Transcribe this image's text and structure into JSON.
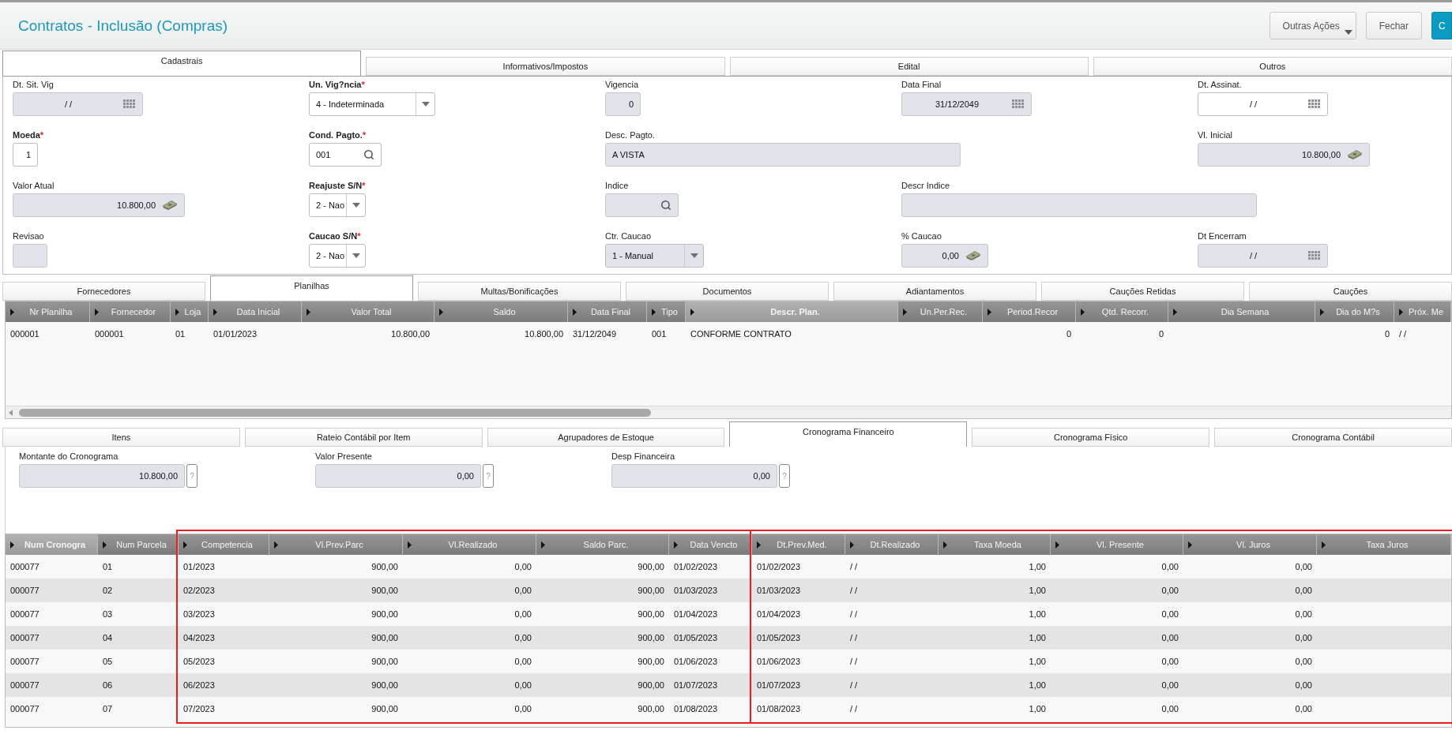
{
  "window": {
    "title": "Contratos - Inclusão (Compras)"
  },
  "actions": [
    {
      "label": "Outras Ações",
      "kind": "menu"
    },
    {
      "label": "Fechar",
      "kind": "default"
    },
    {
      "label": "C",
      "kind": "primary"
    }
  ],
  "main_tabs": [
    {
      "label": "Cadastrais",
      "selected": true
    },
    {
      "label": "Informativos/Impostos",
      "selected": false
    },
    {
      "label": "Edital",
      "selected": false
    },
    {
      "label": "Outros",
      "selected": false
    }
  ],
  "fields": [
    {
      "label": "Dt. Sit. Vig",
      "required": false,
      "kind": "date",
      "disabled": true,
      "value": "/ /"
    },
    {
      "label": "Un. Vig?ncia",
      "required": true,
      "asterisk": "*",
      "kind": "select",
      "disabled": false,
      "value": "4 - Indeterminada"
    },
    {
      "label": "Vigencia",
      "required": false,
      "kind": "number",
      "disabled": true,
      "value": "0"
    },
    {
      "label": "Data Final",
      "required": false,
      "kind": "date",
      "disabled": true,
      "value": "31/12/2049"
    },
    {
      "label": "Dt. Assinat.",
      "required": false,
      "kind": "date",
      "disabled": false,
      "value": "/ /"
    },
    {
      "label": "Moeda",
      "required": true,
      "asterisk": "*",
      "kind": "number",
      "disabled": false,
      "value": "1"
    },
    {
      "label": "Cond. Pagto.",
      "required": true,
      "asterisk": "*",
      "kind": "search",
      "disabled": false,
      "value": "001"
    },
    {
      "label": "Desc. Pagto.",
      "required": false,
      "kind": "text",
      "disabled": true,
      "value": "A VISTA"
    },
    {
      "label": "Vl. Inicial",
      "required": false,
      "kind": "money",
      "disabled": true,
      "value": "10.800,00"
    },
    {
      "label": "Valor Atual",
      "required": false,
      "kind": "money",
      "disabled": true,
      "value": "10.800,00"
    },
    {
      "label": "Reajuste S/N",
      "required": true,
      "asterisk": "*",
      "kind": "select",
      "disabled": false,
      "value": "2 - Nao"
    },
    {
      "label": "Indice",
      "required": false,
      "kind": "search",
      "disabled": true
    },
    {
      "label": "Descr Indice",
      "required": false,
      "kind": "text",
      "disabled": true
    },
    {
      "label": "Revisao",
      "required": false,
      "kind": "text",
      "disabled": true
    },
    {
      "label": "Caucao S/N",
      "required": true,
      "asterisk": "*",
      "kind": "select",
      "disabled": false,
      "value": "2 - Nao"
    },
    {
      "label": "Ctr. Caucao",
      "required": false,
      "kind": "select",
      "disabled": true,
      "value": "1 - Manual"
    },
    {
      "label": "% Caucao",
      "required": false,
      "kind": "money",
      "disabled": true,
      "value": "0,00"
    },
    {
      "label": "Dt Encerram",
      "required": false,
      "kind": "date",
      "disabled": true,
      "value": "/ /"
    }
  ],
  "detail_tabs": [
    {
      "label": "Fornecedores",
      "selected": false
    },
    {
      "label": "Planilhas",
      "selected": true
    },
    {
      "label": "Multas/Bonificações",
      "selected": false
    },
    {
      "label": "Documentos",
      "selected": false
    },
    {
      "label": "Adiantamentos",
      "selected": false
    },
    {
      "label": "Cauções Retidas",
      "selected": false
    },
    {
      "label": "Cauções",
      "selected": false
    }
  ],
  "planilhas": {
    "columns": [
      {
        "label": "Nr Planilha",
        "kind": "text",
        "selected": false
      },
      {
        "label": "Fornecedor",
        "kind": "text",
        "selected": false
      },
      {
        "label": "Loja",
        "kind": "text",
        "selected": false
      },
      {
        "label": "Data Inicial",
        "kind": "text",
        "selected": false
      },
      {
        "label": "Valor Total",
        "kind": "number",
        "selected": false
      },
      {
        "label": "Saldo",
        "kind": "number",
        "selected": false
      },
      {
        "label": "Data Final",
        "kind": "text",
        "selected": false
      },
      {
        "label": "Tipo",
        "kind": "text",
        "selected": false
      },
      {
        "label": "Descr. Plan.",
        "kind": "text",
        "selected": true
      },
      {
        "label": "Un.Per.Rec.",
        "kind": "text",
        "selected": false
      },
      {
        "label": "Period.Recor",
        "kind": "number",
        "selected": false
      },
      {
        "label": "Qtd. Recorr.",
        "kind": "number",
        "selected": false
      },
      {
        "label": "Dia Semana",
        "kind": "text",
        "selected": false
      },
      {
        "label": "Dia do M?s",
        "kind": "number",
        "selected": false
      },
      {
        "label": "Próx. Me",
        "kind": "text",
        "selected": false
      }
    ],
    "rows": [
      [
        "000001",
        "000001",
        "01",
        "01/01/2023",
        "10.800,00",
        "10.800,00",
        "31/12/2049",
        "001",
        "CONFORME CONTRATO",
        null,
        "0",
        "0",
        null,
        "0",
        "/ /"
      ]
    ]
  },
  "item_tabs": [
    {
      "label": "Itens",
      "selected": false
    },
    {
      "label": "Rateio Contábil por Item",
      "selected": false
    },
    {
      "label": "Agrupadores de Estoque",
      "selected": false
    },
    {
      "label": "Cronograma Financeiro",
      "selected": true
    },
    {
      "label": "Cronograma Físico",
      "selected": false
    },
    {
      "label": "Cronograma Contábil",
      "selected": false
    }
  ],
  "totals": [
    {
      "label": "Montante do Cronograma",
      "value": "10.800,00",
      "help": "?"
    },
    {
      "label": "Valor Presente",
      "value": "0,00",
      "help": "?"
    },
    {
      "label": "Desp Financeira",
      "value": "0,00",
      "help": "?"
    }
  ],
  "cronograma": {
    "columns": [
      {
        "label": "Num Cronogra",
        "kind": "text",
        "selected": true,
        "marked": false
      },
      {
        "label": "Num Parcela",
        "kind": "text",
        "selected": false,
        "marked": false
      },
      {
        "label": "Competencia",
        "kind": "text",
        "selected": false,
        "marked": true
      },
      {
        "label": "Vl.Prev.Parc",
        "kind": "number",
        "selected": false,
        "marked": false
      },
      {
        "label": "Vl.Realizado",
        "kind": "number",
        "selected": false,
        "marked": false
      },
      {
        "label": "Saldo Parc.",
        "kind": "number",
        "selected": false,
        "marked": false
      },
      {
        "label": "Data Vencto",
        "kind": "text",
        "selected": false,
        "marked": false
      },
      {
        "label": "Dt.Prev.Med.",
        "kind": "text",
        "selected": false,
        "marked": true
      },
      {
        "label": "Dt.Realizado",
        "kind": "text",
        "selected": false,
        "marked": false
      },
      {
        "label": "Taxa Moeda",
        "kind": "number",
        "selected": false,
        "marked": false
      },
      {
        "label": "Vl. Presente",
        "kind": "number",
        "selected": false,
        "marked": false
      },
      {
        "label": "Vl. Juros",
        "kind": "number",
        "selected": false,
        "marked": false
      },
      {
        "label": "Taxa Juros",
        "kind": "number",
        "selected": false,
        "marked": false
      }
    ],
    "rows": [
      [
        "000077",
        "01",
        "01/2023",
        "900,00",
        "0,00",
        "900,00",
        "01/02/2023",
        "01/02/2023",
        "/ /",
        "1,00",
        "0,00",
        "0,00",
        null
      ],
      [
        "000077",
        "02",
        "02/2023",
        "900,00",
        "0,00",
        "900,00",
        "01/03/2023",
        "01/03/2023",
        "/ /",
        "1,00",
        "0,00",
        "0,00",
        null
      ],
      [
        "000077",
        "03",
        "03/2023",
        "900,00",
        "0,00",
        "900,00",
        "01/04/2023",
        "01/04/2023",
        "/ /",
        "1,00",
        "0,00",
        "0,00",
        null
      ],
      [
        "000077",
        "04",
        "04/2023",
        "900,00",
        "0,00",
        "900,00",
        "01/05/2023",
        "01/05/2023",
        "/ /",
        "1,00",
        "0,00",
        "0,00",
        null
      ],
      [
        "000077",
        "05",
        "05/2023",
        "900,00",
        "0,00",
        "900,00",
        "01/06/2023",
        "01/06/2023",
        "/ /",
        "1,00",
        "0,00",
        "0,00",
        null
      ],
      [
        "000077",
        "06",
        "06/2023",
        "900,00",
        "0,00",
        "900,00",
        "01/07/2023",
        "01/07/2023",
        "/ /",
        "1,00",
        "0,00",
        "0,00",
        null
      ],
      [
        "000077",
        "07",
        "07/2023",
        "900,00",
        "0,00",
        "900,00",
        "01/08/2023",
        "01/08/2023",
        "/ /",
        "1,00",
        "0,00",
        "0,00",
        null
      ]
    ]
  }
}
